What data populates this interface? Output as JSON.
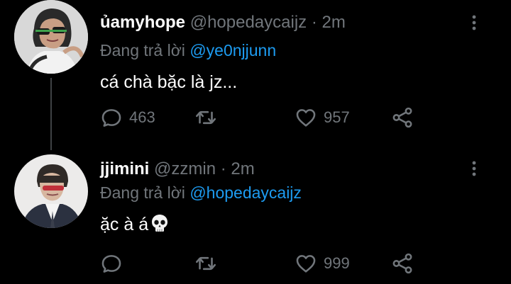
{
  "tweets": [
    {
      "display_name": "ủamyhope",
      "handle": "@hopedaycaijz",
      "separator": "·",
      "time": "2m",
      "reply_prefix": "Đang trả lời",
      "reply_to": "@ye0njjunn",
      "text": "cá chà bặc là jz...",
      "replies": "463",
      "retweets": "",
      "likes": "957",
      "avatar": "avatar-person-sunglasses"
    },
    {
      "display_name": "jjimini",
      "handle": "@zzmin",
      "separator": "·",
      "time": "2m",
      "reply_prefix": "Đang trả lời",
      "reply_to": "@hopedaycaijz",
      "text": "ặc à á",
      "emoji": "skull-icon",
      "replies": "",
      "retweets": "",
      "likes": "999",
      "avatar": "avatar-person-suit"
    }
  ],
  "icons": {
    "reply": "reply-icon",
    "retweet": "retweet-icon",
    "like": "heart-icon",
    "share": "share-icon",
    "more": "more-vertical-icon"
  },
  "colors": {
    "background": "#000000",
    "text": "#ffffff",
    "secondary": "#71767b",
    "link": "#1d9bf0",
    "thread_line": "#3e4144"
  }
}
